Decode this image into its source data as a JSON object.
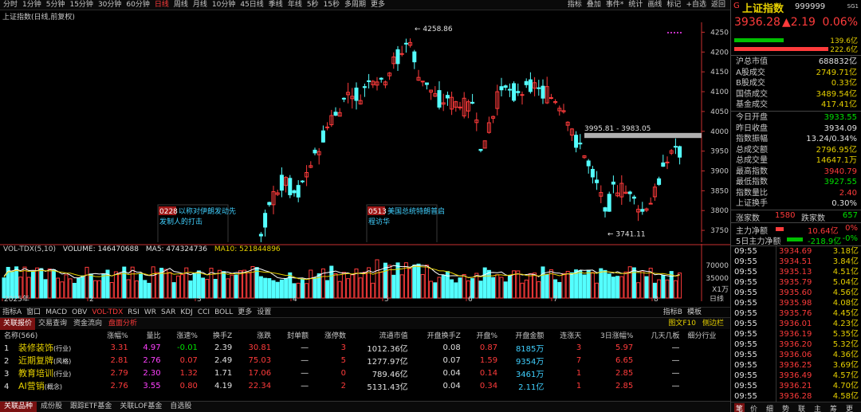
{
  "topbar": {
    "periods": [
      "分时",
      "1分钟",
      "5分钟",
      "15分钟",
      "30分钟",
      "60分钟",
      "日线",
      "周线",
      "月线",
      "10分钟",
      "45日线",
      "季线",
      "年线",
      "5秒",
      "15秒",
      "多周期",
      "更多"
    ],
    "active_period": "日线",
    "right_menu": [
      "指标",
      "叠加",
      "事件*",
      "统计",
      "画线",
      "标记",
      "+自选",
      "返回"
    ]
  },
  "chart": {
    "title": "上证指数(日线,前复权)",
    "price_axis": [
      "4250",
      "4200",
      "4150",
      "4100",
      "4050",
      "4000",
      "3950",
      "3900",
      "3850",
      "3800",
      "3750"
    ],
    "ylim": [
      3720,
      4275
    ],
    "high_label": "4258.86",
    "low_label": "3741.11",
    "gap_label": "3995.81 - 3983.05",
    "events": [
      {
        "date": "0228",
        "text": "以称对伊朗发动先发制人的打击"
      },
      {
        "date": "0513",
        "text": "美国总统特朗普启程访华"
      }
    ],
    "x_labels": [
      "2025年",
      "2",
      "3",
      "4",
      "5",
      "6",
      "7",
      "8"
    ],
    "dates_right": "日线",
    "vol_header": {
      "name": "VOL-TDX(5,10)",
      "volume": "VOLUME: 146470688",
      "ma5": "MA5: 474324736",
      "ma10": "MA10: 521844896"
    },
    "vol_axis": [
      "70000",
      "35000",
      "X1万"
    ],
    "colors": {
      "up": "#ff3b3b",
      "down": "#54ffff",
      "ma5": "#ffffff",
      "ma10": "#e6d000"
    }
  },
  "indicator_tabs": [
    "指标A",
    "窗口",
    "MACD",
    "OBV",
    "VOL-TDX",
    "RSI",
    "WR",
    "SAR",
    "KDJ",
    "CCI",
    "BOLL",
    "更多",
    "设置"
  ],
  "indicator_right": [
    "指标B",
    "模板"
  ],
  "table_tabs": [
    "关联报价",
    "交易查询",
    "资金流向",
    "盘面分析"
  ],
  "table_tabs_right": [
    "图文F10",
    "侧边栏"
  ],
  "table": {
    "headers": [
      "名称(566)",
      "涨幅%",
      "量比",
      "涨速%",
      "换手Z",
      "涨跌",
      "封单额",
      "涨停数",
      "流通市值",
      "开盘换手Z",
      "开盘%",
      "开盘金额",
      "连涨天",
      "3日涨幅%",
      "几天几板",
      "细分行业"
    ],
    "rows": [
      {
        "no": "1",
        "name": "装修装饰",
        "tag": "(行业)",
        "chg": "3.31",
        "vr": "4.97",
        "speed": "-0.01",
        "turn": "2.39",
        "delta": "30.81",
        "seal": "—",
        "limit": "3",
        "mcap": "1012.36亿",
        "oturn": "0.08",
        "open": "0.87",
        "oamt": "8185万",
        "days": "3",
        "d3": "5.97",
        "boards": "—",
        "ind": ""
      },
      {
        "no": "2",
        "name": "近期复牌",
        "tag": "(风格)",
        "chg": "2.81",
        "vr": "2.76",
        "speed": "0.07",
        "turn": "2.49",
        "delta": "75.03",
        "seal": "—",
        "limit": "5",
        "mcap": "1277.97亿",
        "oturn": "0.07",
        "open": "1.59",
        "oamt": "9354万",
        "days": "7",
        "d3": "6.65",
        "boards": "—",
        "ind": ""
      },
      {
        "no": "3",
        "name": "教育培训",
        "tag": "(行业)",
        "chg": "2.79",
        "vr": "2.30",
        "speed": "1.32",
        "turn": "1.71",
        "delta": "17.06",
        "seal": "—",
        "limit": "0",
        "mcap": "789.46亿",
        "oturn": "0.04",
        "open": "0.14",
        "oamt": "3461万",
        "days": "1",
        "d3": "2.85",
        "boards": "—",
        "ind": ""
      },
      {
        "no": "4",
        "name": "AI营销",
        "tag": "(概念)",
        "chg": "2.76",
        "vr": "3.55",
        "speed": "0.80",
        "turn": "4.19",
        "delta": "22.34",
        "seal": "—",
        "limit": "2",
        "mcap": "5131.43亿",
        "oturn": "0.04",
        "open": "0.34",
        "oamt": "2.11亿",
        "days": "1",
        "d3": "2.85",
        "boards": "—",
        "ind": ""
      }
    ]
  },
  "bottom_tabs": [
    "关联品种",
    "成份股",
    "跟踪ETF基金",
    "关联LOF基金",
    "自选股"
  ],
  "panel": {
    "badge": "G",
    "name": "上证指数",
    "code": "999999",
    "sg": "SG1",
    "price": "3936.28",
    "change": "▲2.19",
    "pct": "0.06%",
    "bar1_val": "139.6亿",
    "bar2_val": "222.6亿",
    "market": [
      {
        "k": "沪总市值",
        "v": "688832亿",
        "c": "wht"
      },
      {
        "k": "A股成交",
        "v": "2749.71亿",
        "c": "yel"
      },
      {
        "k": "B股成交",
        "v": "0.33亿",
        "c": "yel"
      },
      {
        "k": "国债成交",
        "v": "3489.54亿",
        "c": "yel"
      },
      {
        "k": "基金成交",
        "v": "417.41亿",
        "c": "yel"
      }
    ],
    "stats": [
      {
        "k": "今日开盘",
        "v": "3933.55",
        "c": "green"
      },
      {
        "k": "昨日收盘",
        "v": "3934.09",
        "c": "wht"
      },
      {
        "k": "指数振幅",
        "v": "13.24/0.34%",
        "c": "wht"
      },
      {
        "k": "总成交额",
        "v": "2796.95亿",
        "c": "yel"
      },
      {
        "k": "总成交量",
        "v": "14647.1万",
        "c": "yel"
      },
      {
        "k": "最高指数",
        "v": "3940.79",
        "c": "red"
      },
      {
        "k": "最低指数",
        "v": "3927.55",
        "c": "green"
      },
      {
        "k": "指数量比",
        "v": "2.40",
        "c": "red"
      },
      {
        "k": "上证换手",
        "v": "0.30%",
        "c": "wht"
      }
    ],
    "up_label": "涨家数",
    "up_val": "1580",
    "down_label": "跌家数",
    "down_val": "657",
    "main_flow_label": "主力净额",
    "main_flow_val": "10.64亿",
    "main_flow_pct": "0%",
    "flow5_label": "5日主力净额",
    "flow5_val": "-218.9亿",
    "flow5_pct": "-0%",
    "ticks": [
      {
        "t": "09:55",
        "p": "3934.69",
        "v": "3.18亿"
      },
      {
        "t": "09:55",
        "p": "3934.51",
        "v": "3.84亿"
      },
      {
        "t": "09:55",
        "p": "3935.13",
        "v": "4.51亿"
      },
      {
        "t": "09:55",
        "p": "3935.79",
        "v": "5.04亿"
      },
      {
        "t": "09:55",
        "p": "3935.60",
        "v": "4.56亿"
      },
      {
        "t": "09:55",
        "p": "3935.98",
        "v": "4.08亿"
      },
      {
        "t": "09:55",
        "p": "3935.76",
        "v": "4.45亿"
      },
      {
        "t": "09:55",
        "p": "3936.01",
        "v": "4.23亿"
      },
      {
        "t": "09:55",
        "p": "3936.19",
        "v": "5.35亿"
      },
      {
        "t": "09:55",
        "p": "3936.20",
        "v": "5.32亿"
      },
      {
        "t": "09:55",
        "p": "3936.06",
        "v": "4.36亿"
      },
      {
        "t": "09:55",
        "p": "3936.25",
        "v": "3.69亿"
      },
      {
        "t": "09:55",
        "p": "3936.49",
        "v": "4.57亿"
      },
      {
        "t": "09:55",
        "p": "3936.21",
        "v": "4.70亿"
      },
      {
        "t": "09:55",
        "p": "3936.28",
        "v": "4.58亿"
      }
    ],
    "bottom_tabs": [
      "笔",
      "价",
      "细",
      "势",
      "联",
      "主",
      "筹",
      "更"
    ]
  }
}
